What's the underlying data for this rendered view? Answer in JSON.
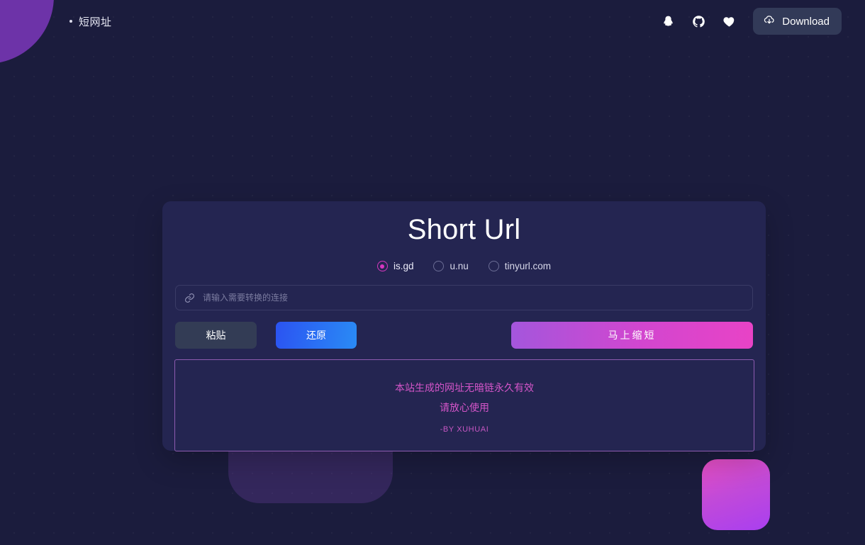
{
  "header": {
    "brand": "短网址",
    "icons": [
      {
        "name": "qq-icon",
        "label": "QQ"
      },
      {
        "name": "github-icon",
        "label": "GitHub"
      },
      {
        "name": "heart-icon",
        "label": "Favorite"
      }
    ],
    "download_label": "Download"
  },
  "card": {
    "title": "Short Url",
    "services": [
      {
        "label": "is.gd",
        "selected": true
      },
      {
        "label": "u.nu",
        "selected": false
      },
      {
        "label": "tinyurl.com",
        "selected": false
      }
    ],
    "input": {
      "placeholder": "请输入需要转换的连接",
      "value": ""
    },
    "buttons": {
      "paste": "粘贴",
      "restore": "还原",
      "shorten": "马上缩短"
    },
    "notice": {
      "line1": "本站生成的网址无暗链永久有效",
      "line2": "请放心使用",
      "signature": "-BY XUHUAI"
    }
  },
  "colors": {
    "page_bg": "#1b1c3d",
    "card_bg": "#242551",
    "accent_pink": "#d737c0",
    "accent_purple": "#6d33a8",
    "blue_button": "#2b53f2",
    "notice_border": "#8d5bb0"
  }
}
